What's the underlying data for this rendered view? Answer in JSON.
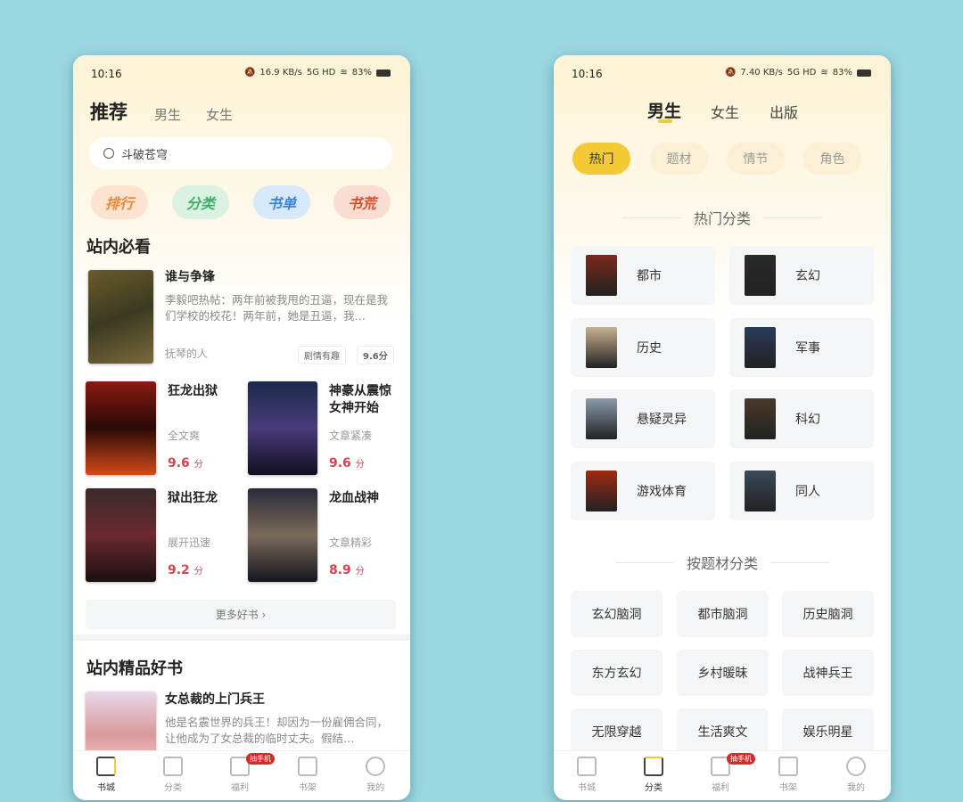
{
  "left": {
    "status": {
      "time": "10:16",
      "speed": "16.9 KB/s",
      "network": "5G HD",
      "battery": "83%"
    },
    "tabs": [
      {
        "label": "推荐",
        "active": true
      },
      {
        "label": "男生"
      },
      {
        "label": "女生"
      }
    ],
    "search": {
      "placeholder": "斗破苍穹"
    },
    "quick": [
      {
        "label": "排行",
        "color": "#e88a3a"
      },
      {
        "label": "分类",
        "color": "#3fae6a"
      },
      {
        "label": "书单",
        "color": "#3c84d8"
      },
      {
        "label": "书荒",
        "color": "#d9502e"
      }
    ],
    "section1": {
      "title": "站内必看",
      "featured": {
        "title": "谁与争锋",
        "desc": "李毅吧热帖：两年前被我甩的丑逼，现在是我们学校的校花！两年前，她是丑逼，我…",
        "author": "抚琴的人",
        "tag": "剧情有趣",
        "score": "9.6分"
      },
      "books": [
        {
          "title": "狂龙出狱",
          "tag": "全文爽",
          "score": "9.6",
          "unit": "分"
        },
        {
          "title": "神豪从震惊女神开始",
          "tag": "文章紧凑",
          "score": "9.6",
          "unit": "分"
        },
        {
          "title": "狱出狂龙",
          "tag": "展开迅速",
          "score": "9.2",
          "unit": "分"
        },
        {
          "title": "龙血战神",
          "tag": "文章精彩",
          "score": "8.9",
          "unit": "分"
        }
      ],
      "more": "更多好书 ›"
    },
    "section2": {
      "title": "站内精品好书",
      "book": {
        "title": "女总裁的上门兵王",
        "desc": "他是名震世界的兵王！却因为一份雇佣合同，让他成为了女总裁的临时丈夫。假结…"
      }
    }
  },
  "right": {
    "status": {
      "time": "10:16",
      "speed": "7.40 KB/s",
      "network": "5G HD",
      "battery": "83%"
    },
    "tabs": [
      {
        "label": "男生",
        "active": true
      },
      {
        "label": "女生"
      },
      {
        "label": "出版"
      }
    ],
    "chips": [
      {
        "label": "热门",
        "active": true
      },
      {
        "label": "题材"
      },
      {
        "label": "情节"
      },
      {
        "label": "角色"
      }
    ],
    "hot_title": "热门分类",
    "hot": [
      "都市",
      "玄幻",
      "历史",
      "军事",
      "悬疑灵异",
      "科幻",
      "游戏体育",
      "同人"
    ],
    "theme_title": "按题材分类",
    "themes": [
      "玄幻脑洞",
      "都市脑洞",
      "历史脑洞",
      "东方玄幻",
      "乡村暖昧",
      "战神兵王",
      "无限穿越",
      "生活爽文",
      "娱乐明星"
    ]
  },
  "tabbar": {
    "items": [
      "书城",
      "分类",
      "福利",
      "书架",
      "我的"
    ],
    "badge": "抽手机"
  },
  "colors": {
    "accent": "#f3c935",
    "score": "#d9434a",
    "badge": "#d32b2b"
  }
}
